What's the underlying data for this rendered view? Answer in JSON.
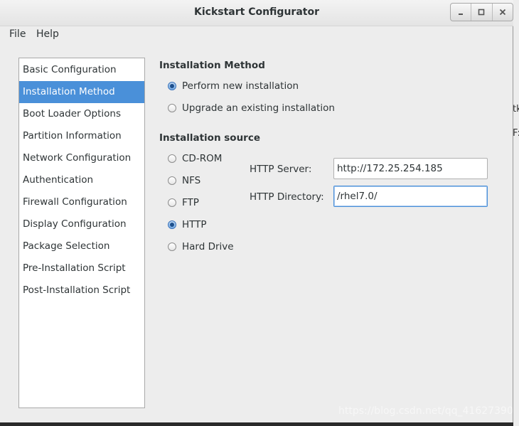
{
  "window": {
    "title": "Kickstart Configurator"
  },
  "window_controls": {
    "minimize_icon": "minimize-icon",
    "maximize_icon": "maximize-icon",
    "close_icon": "close-icon"
  },
  "menubar": {
    "file": "File",
    "help": "Help"
  },
  "sidebar": {
    "items": [
      {
        "label": "Basic Configuration",
        "selected": false
      },
      {
        "label": "Installation Method",
        "selected": true
      },
      {
        "label": "Boot Loader Options",
        "selected": false
      },
      {
        "label": "Partition Information",
        "selected": false
      },
      {
        "label": "Network Configuration",
        "selected": false
      },
      {
        "label": "Authentication",
        "selected": false
      },
      {
        "label": "Firewall Configuration",
        "selected": false
      },
      {
        "label": "Display Configuration",
        "selected": false
      },
      {
        "label": "Package Selection",
        "selected": false
      },
      {
        "label": "Pre-Installation Script",
        "selected": false
      },
      {
        "label": "Post-Installation Script",
        "selected": false
      }
    ]
  },
  "installation_method": {
    "title": "Installation Method",
    "options": [
      {
        "label": "Perform new installation",
        "checked": true
      },
      {
        "label": "Upgrade an existing installation",
        "checked": false
      }
    ]
  },
  "installation_source": {
    "title": "Installation source",
    "options": [
      {
        "label": "CD-ROM",
        "checked": false
      },
      {
        "label": "NFS",
        "checked": false
      },
      {
        "label": "FTP",
        "checked": false
      },
      {
        "label": "HTTP",
        "checked": true
      },
      {
        "label": "Hard Drive",
        "checked": false
      }
    ],
    "http_server_label": "HTTP Server:",
    "http_server_value": "http://172.25.254.185",
    "http_directory_label": "HTTP Directory:",
    "http_directory_value": "/rhel7.0/"
  },
  "background_fragments": {
    "frag1": "tk",
    "frag2": "F:"
  },
  "watermark": "https://blog.csdn.net/qq_41627390",
  "colors": {
    "selection": "#4a90d9",
    "radio_checked": "#1d4f8c"
  }
}
